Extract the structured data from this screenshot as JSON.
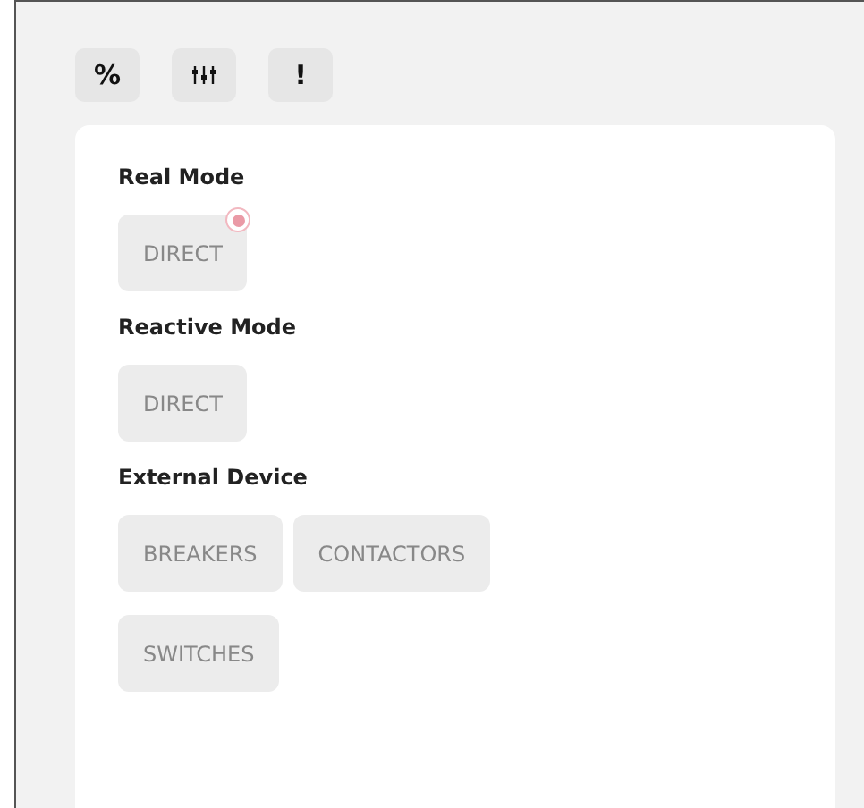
{
  "toolbar": [
    {
      "kind": "text",
      "label": "%"
    },
    {
      "kind": "sliders"
    },
    {
      "kind": "text",
      "label": "!"
    }
  ],
  "sections": [
    {
      "title": "Real Mode",
      "options": [
        {
          "label": "DIRECT",
          "alert": true
        }
      ]
    },
    {
      "title": "Reactive Mode",
      "options": [
        {
          "label": "DIRECT",
          "alert": false
        }
      ]
    },
    {
      "title": "External Device",
      "options": [
        {
          "label": "BREAKERS",
          "alert": false
        },
        {
          "label": "CONTACTORS",
          "alert": false
        },
        {
          "label": "SWITCHES",
          "alert": false
        }
      ]
    }
  ]
}
